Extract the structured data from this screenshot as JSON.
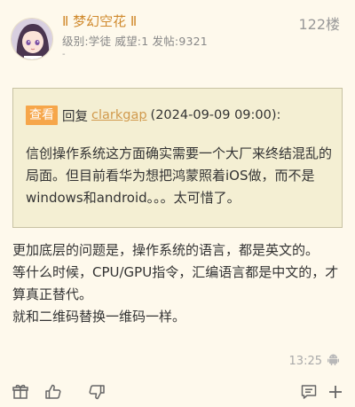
{
  "post": {
    "username": "Ⅱ 梦幻空花 Ⅱ",
    "user_stats": "级别:学徒 威望:1 发帖:9321",
    "signature": "-",
    "floor": "122楼",
    "quote": {
      "view_label": "查看",
      "reply_label": "回复",
      "reply_user": "clarkgap",
      "reply_time": "(2024-09-09 09:00):",
      "text": "信创操作系统这方面确实需要一个大厂来终结混乱的局面。但目前看华为想把鸿蒙照着iOS做，而不是windows和android。。。太可惜了。"
    },
    "content": [
      "更加底层的问题是，操作系统的语言，都是英文的。",
      "等什么时候，CPU/GPU指令，汇编语言都是中文的，才算真正替代。",
      "就和二维码替换一维码一样。"
    ],
    "time": "13:25",
    "device_icon": "android-icon"
  },
  "actions": [
    "gift-icon",
    "like-icon",
    "dislike-icon",
    "comment-icon",
    "add-icon"
  ],
  "colors": {
    "background": "#fef9ec",
    "username": "#d08a2e",
    "view_button": "#f6a64a",
    "quote_bg": "#f4efd3",
    "link": "#d19a4d"
  }
}
